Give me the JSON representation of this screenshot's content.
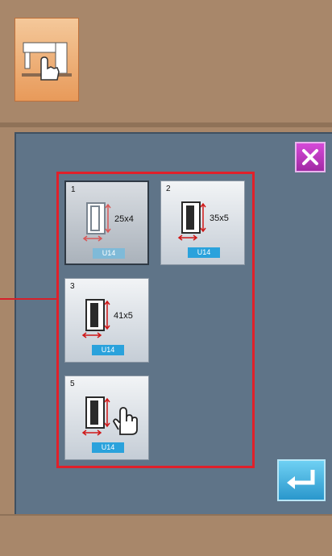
{
  "toolbar": {
    "machine_icon": "sewing-machine-hand-icon"
  },
  "dialog": {
    "close_icon": "close-icon",
    "enter_icon": "enter-return-icon",
    "tiles": [
      {
        "number": "1",
        "size": "25x4",
        "tag": "U14",
        "selected": true
      },
      {
        "number": "2",
        "size": "35x5",
        "tag": "U14",
        "selected": false
      },
      {
        "number": "3",
        "size": "41x5",
        "tag": "U14",
        "selected": false
      },
      {
        "number": "5",
        "size": "",
        "tag": "U14",
        "selected": false,
        "icon": "hand-pointer-icon"
      }
    ]
  },
  "colors": {
    "background": "#a8876a",
    "panel": "#5f7488",
    "highlight_frame": "#e0202a",
    "tag": "#2aa2dc",
    "close_button": "#c03ac4",
    "enter_button": "#3fb2e3"
  }
}
